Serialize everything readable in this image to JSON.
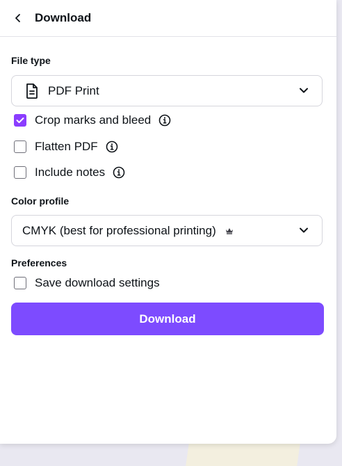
{
  "header": {
    "title": "Download"
  },
  "file_type": {
    "label": "File type",
    "selected": "PDF Print",
    "options": {
      "crop_marks": {
        "label": "Crop marks and bleed",
        "checked": true
      },
      "flatten_pdf": {
        "label": "Flatten PDF",
        "checked": false
      },
      "include_notes": {
        "label": "Include notes",
        "checked": false
      }
    }
  },
  "color_profile": {
    "label": "Color profile",
    "selected": "CMYK (best for professional printing)",
    "badge_icon": "crown-icon"
  },
  "preferences": {
    "label": "Preferences",
    "save_settings": {
      "label": "Save download settings",
      "checked": false
    }
  },
  "actions": {
    "download_label": "Download"
  },
  "colors": {
    "accent": "#8b3dff",
    "button": "#7d4bff"
  }
}
